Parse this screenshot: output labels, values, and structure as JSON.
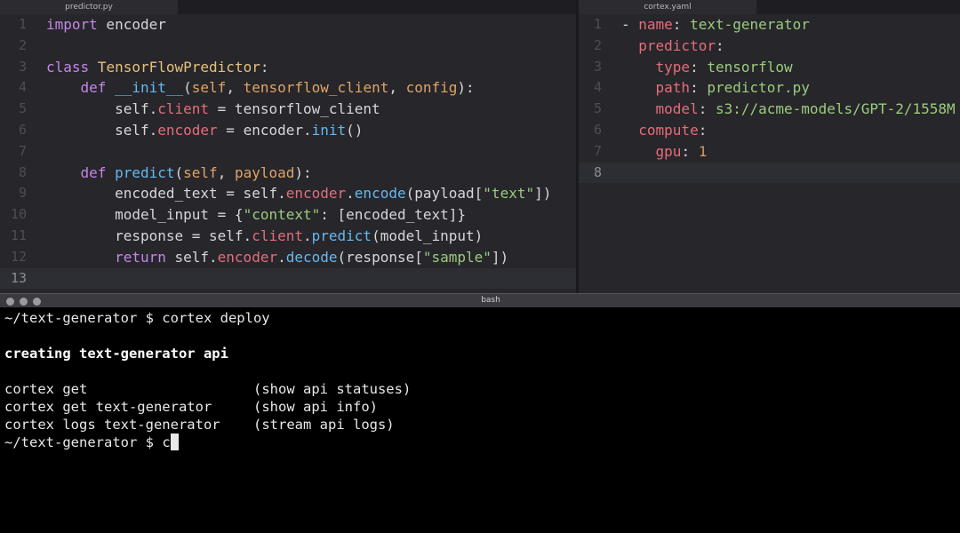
{
  "editor": {
    "left_tab": "predictor.py",
    "right_tab": "cortex.yaml",
    "left_line_numbers": [
      "1",
      "2",
      "3",
      "4",
      "5",
      "6",
      "7",
      "8",
      "9",
      "10",
      "11",
      "12",
      "13"
    ],
    "right_line_numbers": [
      "1",
      "2",
      "3",
      "4",
      "5",
      "6",
      "7",
      "8"
    ],
    "yaml": {
      "name_key": "name",
      "name_val": "text-generator",
      "predictor_key": "predictor",
      "type_key": "type",
      "type_val": "tensorflow",
      "path_key": "path",
      "path_val": "predictor.py",
      "model_key": "model",
      "model_val": "s3://acme-models/GPT-2/1558M",
      "compute_key": "compute",
      "gpu_key": "gpu",
      "gpu_val": "1"
    }
  },
  "terminal": {
    "title": "bash",
    "prompt_cmd": "~/text-generator $ cortex deploy",
    "creating": "creating text-generator api",
    "rows": [
      {
        "cmd": "cortex get",
        "desc": "(show api statuses)"
      },
      {
        "cmd": "cortex get text-generator",
        "desc": "(show api info)"
      },
      {
        "cmd": "cortex logs text-generator",
        "desc": "(stream api logs)"
      }
    ],
    "prompt2": "~/text-generator $ ",
    "typed": "c"
  }
}
